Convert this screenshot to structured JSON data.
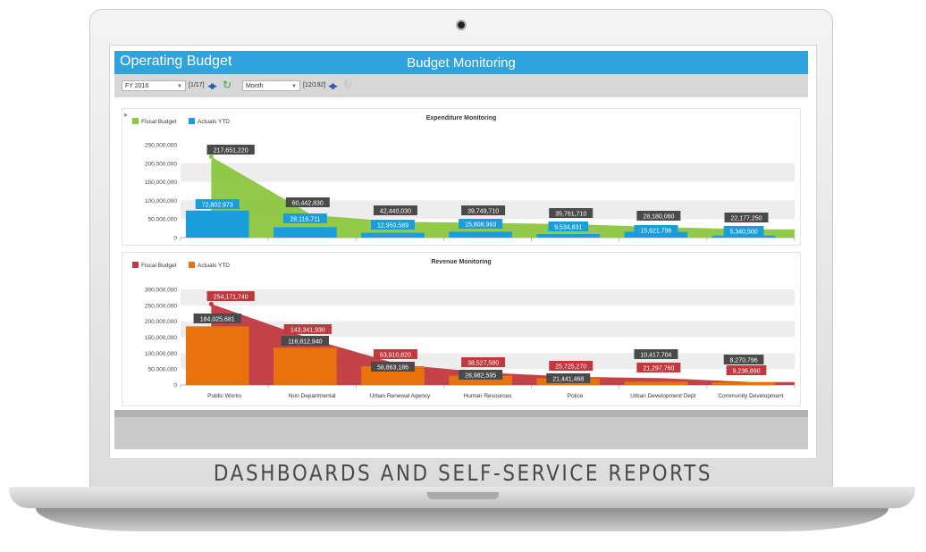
{
  "app": {
    "title": "Operating Budget",
    "page_title": "Budget Monitoring"
  },
  "toolbar": {
    "year_select": "FY 2016",
    "year_pager": "[1/17]",
    "period_select": "Month",
    "period_pager": "[12/192]"
  },
  "caption": "DASHBOARDS AND SELF-SERVICE REPORTS",
  "colors": {
    "header_blue": "#2ea3dc",
    "expense_budget": "#8cc63f",
    "expense_actual": "#1a9ddb",
    "revenue_budget": "#c0393e",
    "revenue_actual": "#e8720c",
    "label_dark": "#4a4a4a"
  },
  "chart_data": [
    {
      "type": "bar",
      "title": "Expenditure Monitoring",
      "ylim": [
        0,
        250000000
      ],
      "yticks": [
        "0",
        "50,000,000",
        "100,000,000",
        "150,000,000",
        "200,000,000",
        "250,000,000"
      ],
      "legend_position": "top-left",
      "categories": [
        "Public Works",
        "Non Departmental",
        "Urban Renewal Agency",
        "Human Resources",
        "Police",
        "Urban Development Dept",
        "Community Development"
      ],
      "series": [
        {
          "name": "Fiscal Budget",
          "render": "area",
          "color": "#8cc63f",
          "values": [
            217651220,
            60442830,
            42440030,
            39749710,
            35761710,
            28180060,
            22177250
          ],
          "labels": [
            "217,651,220",
            "60,442,830",
            "42,440,030",
            "39,749,710",
            "35,761,710",
            "28,180,060",
            "22,177,250"
          ]
        },
        {
          "name": "Actuals YTD",
          "render": "bar",
          "color": "#1a9ddb",
          "values": [
            72802973,
            28116711,
            12950589,
            15808993,
            9534831,
            15621796,
            5340500
          ],
          "labels": [
            "72,802,973",
            "28,116,711",
            "12,950,589",
            "15,808,993",
            "9,534,831",
            "15,621,796",
            "5,340,500"
          ]
        }
      ]
    },
    {
      "type": "bar",
      "title": "Revenue Monitoring",
      "ylim": [
        0,
        300000000
      ],
      "yticks": [
        "0",
        "50,000,000",
        "100,000,000",
        "150,000,000",
        "200,000,000",
        "250,000,000",
        "300,000,000"
      ],
      "legend_position": "top-left",
      "categories": [
        "Public Works",
        "Non Departmental",
        "Urban Renewal Agency",
        "Human Resources",
        "Police",
        "Urban Development Dept",
        "Community Development"
      ],
      "series": [
        {
          "name": "Fiscal Budget",
          "render": "area",
          "color": "#c0393e",
          "values": [
            254171740,
            143341930,
            63910820,
            38527580,
            25725270,
            21297760,
            9236890
          ],
          "labels": [
            "254,171,740",
            "143,341,930",
            "63,910,820",
            "38,527,580",
            "25,725,270",
            "21,297,760",
            "9,236,890"
          ]
        },
        {
          "name": "Actuals YTD",
          "render": "bar",
          "color": "#e8720c",
          "values": [
            184025681,
            116812940,
            58863186,
            28982595,
            21441468,
            10417704,
            8270796
          ],
          "labels": [
            "184,025,681",
            "116,812,940",
            "58,863,186",
            "28,982,595",
            "21,441,468",
            "10,417,704",
            "8,270,796"
          ]
        }
      ]
    }
  ]
}
